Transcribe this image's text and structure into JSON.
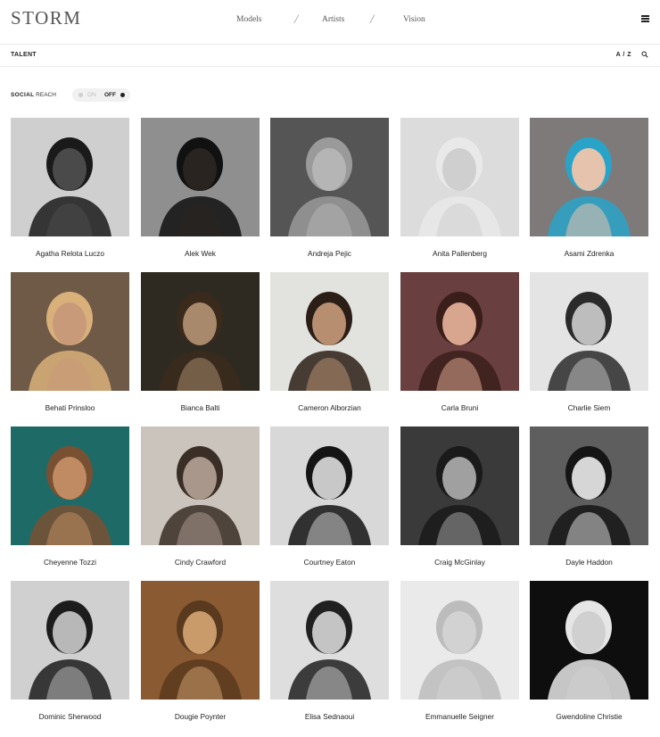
{
  "header": {
    "logo": "STORM",
    "nav": [
      {
        "label": "Models"
      },
      {
        "label": "Artists"
      },
      {
        "label": "Vision"
      }
    ],
    "separator": "/",
    "menu_icon": "hamburger-menu-icon"
  },
  "subbar": {
    "title": "TALENT",
    "sort_label": "A / Z",
    "search_icon": "search-icon"
  },
  "social_reach": {
    "label_bold": "SOCIAL",
    "label_rest": "REACH",
    "on_label": "ON",
    "off_label": "OFF",
    "state": "off"
  },
  "talent": [
    {
      "name": "Agatha Relota Luczo",
      "tone": "#4a4a4a",
      "bg": "#cfcfcf",
      "hair": "#1a1a1a"
    },
    {
      "name": "Alek Wek",
      "tone": "#2a2420",
      "bg": "#8f8f8f",
      "hair": "#111"
    },
    {
      "name": "Andreja Pejic",
      "tone": "#b5b5b5",
      "bg": "#555",
      "hair": "#9a9a9a"
    },
    {
      "name": "Anita Pallenberg",
      "tone": "#cfcfcf",
      "bg": "#dcdcdc",
      "hair": "#e9e9e9"
    },
    {
      "name": "Asami Zdrenka",
      "tone": "#e5c3ad",
      "bg": "#7e7a7a",
      "hair": "#2aa3c8"
    },
    {
      "name": "Behati Prinsloo",
      "tone": "#c99a7a",
      "bg": "#6f5a48",
      "hair": "#d9b07a"
    },
    {
      "name": "Bianca Balti",
      "tone": "#a8896c",
      "bg": "#2e2a22",
      "hair": "#3a2a1c"
    },
    {
      "name": "Cameron Alborzian",
      "tone": "#b88e70",
      "bg": "#e2e2de",
      "hair": "#2a1e16"
    },
    {
      "name": "Carla Bruni",
      "tone": "#d8a58f",
      "bg": "#6a3f3f",
      "hair": "#3a1e1a"
    },
    {
      "name": "Charlie Siem",
      "tone": "#bdbdbd",
      "bg": "#e4e4e4",
      "hair": "#2a2a2a"
    },
    {
      "name": "Cheyenne Tozzi",
      "tone": "#c08a62",
      "bg": "#1e6a66",
      "hair": "#7a5032"
    },
    {
      "name": "Cindy Crawford",
      "tone": "#a8978a",
      "bg": "#cbc4bc",
      "hair": "#3a2e26"
    },
    {
      "name": "Courtney Eaton",
      "tone": "#c8c8c8",
      "bg": "#d8d8d8",
      "hair": "#141414"
    },
    {
      "name": "Craig McGinlay",
      "tone": "#a0a0a0",
      "bg": "#3a3a3a",
      "hair": "#1a1a1a"
    },
    {
      "name": "Dayle Haddon",
      "tone": "#d6d6d6",
      "bg": "#5e5e5e",
      "hair": "#151515"
    },
    {
      "name": "Dominic Sherwood",
      "tone": "#b8b8b8",
      "bg": "#d0d0d0",
      "hair": "#1c1c1c"
    },
    {
      "name": "Dougie Poynter",
      "tone": "#c99a6a",
      "bg": "#8a5a32",
      "hair": "#5a3a1e"
    },
    {
      "name": "Elisa Sednaoui",
      "tone": "#c4c4c4",
      "bg": "#dedede",
      "hair": "#202020"
    },
    {
      "name": "Emmanuelle Seigner",
      "tone": "#d2d2d2",
      "bg": "#eaeaea",
      "hair": "#bcbcbc"
    },
    {
      "name": "Gwendoline Christie",
      "tone": "#d0d0d0",
      "bg": "#0e0e0e",
      "hair": "#e6e6e6"
    }
  ]
}
